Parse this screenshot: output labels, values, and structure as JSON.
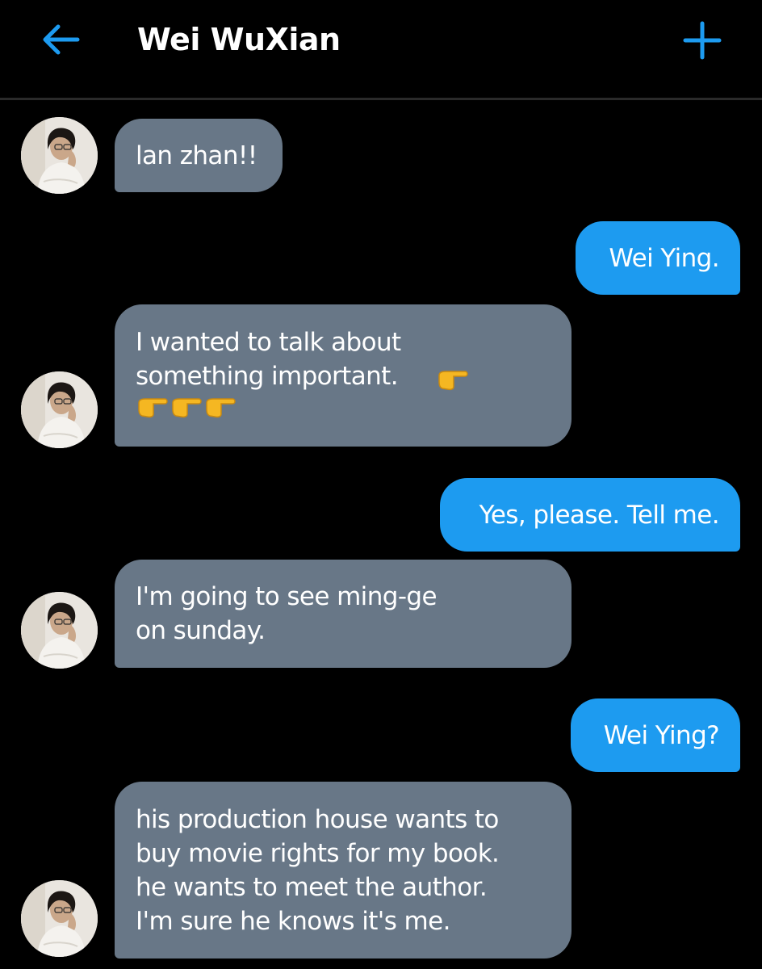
{
  "header": {
    "title": "Wei WuXian",
    "back_icon": "arrow-left-icon",
    "add_icon": "plus-icon",
    "accent_color": "#1d9bf0"
  },
  "colors": {
    "background": "#000000",
    "incoming_bubble": "#687787",
    "outgoing_bubble": "#1d9bf0",
    "text": "#ffffff"
  },
  "messages": [
    {
      "direction": "incoming",
      "text": "lan zhan!!"
    },
    {
      "direction": "outgoing",
      "text": "Wei Ying."
    },
    {
      "direction": "incoming",
      "text": "I wanted to talk about\nsomething important.",
      "emojis": [
        "backhand-index-pointing-right",
        "backhand-index-pointing-right",
        "backhand-index-pointing-right",
        "backhand-index-pointing-right"
      ]
    },
    {
      "direction": "outgoing",
      "text": "Yes, please. Tell me."
    },
    {
      "direction": "incoming",
      "text": "I'm going to see ming-ge\non sunday."
    },
    {
      "direction": "outgoing",
      "text": "Wei Ying?"
    },
    {
      "direction": "incoming",
      "text": "his production house wants to\nbuy movie rights for my book.\nhe wants to meet the author.\nI'm sure he knows it's me."
    }
  ]
}
